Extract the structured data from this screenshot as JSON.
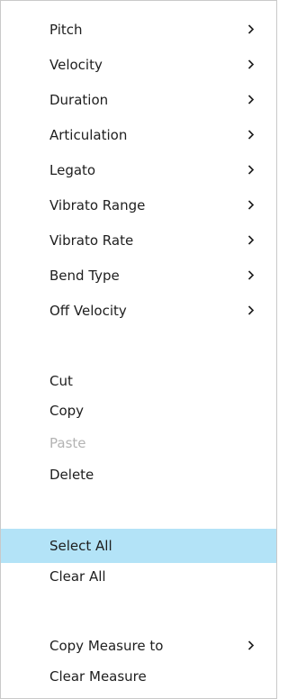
{
  "menu": {
    "items": [
      {
        "label": "Pitch",
        "submenu": true
      },
      {
        "label": "Velocity",
        "submenu": true
      },
      {
        "label": "Duration",
        "submenu": true
      },
      {
        "label": "Articulation",
        "submenu": true
      },
      {
        "label": "Legato",
        "submenu": true
      },
      {
        "label": "Vibrato Range",
        "submenu": true
      },
      {
        "label": "Vibrato Rate",
        "submenu": true
      },
      {
        "label": "Bend Type",
        "submenu": true
      },
      {
        "label": "Off Velocity",
        "submenu": true
      },
      {
        "label": "Cut"
      },
      {
        "label": "Copy"
      },
      {
        "label": "Paste",
        "disabled": true
      },
      {
        "label": "Delete"
      },
      {
        "label": "Select All",
        "highlighted": true
      },
      {
        "label": "Clear All"
      },
      {
        "label": "Copy Measure to",
        "submenu": true
      },
      {
        "label": "Clear Measure"
      }
    ],
    "submenu_icon": "chevron-right-icon",
    "highlight_color": "#b3e3f7",
    "disabled_color": "#b3b3b3"
  }
}
